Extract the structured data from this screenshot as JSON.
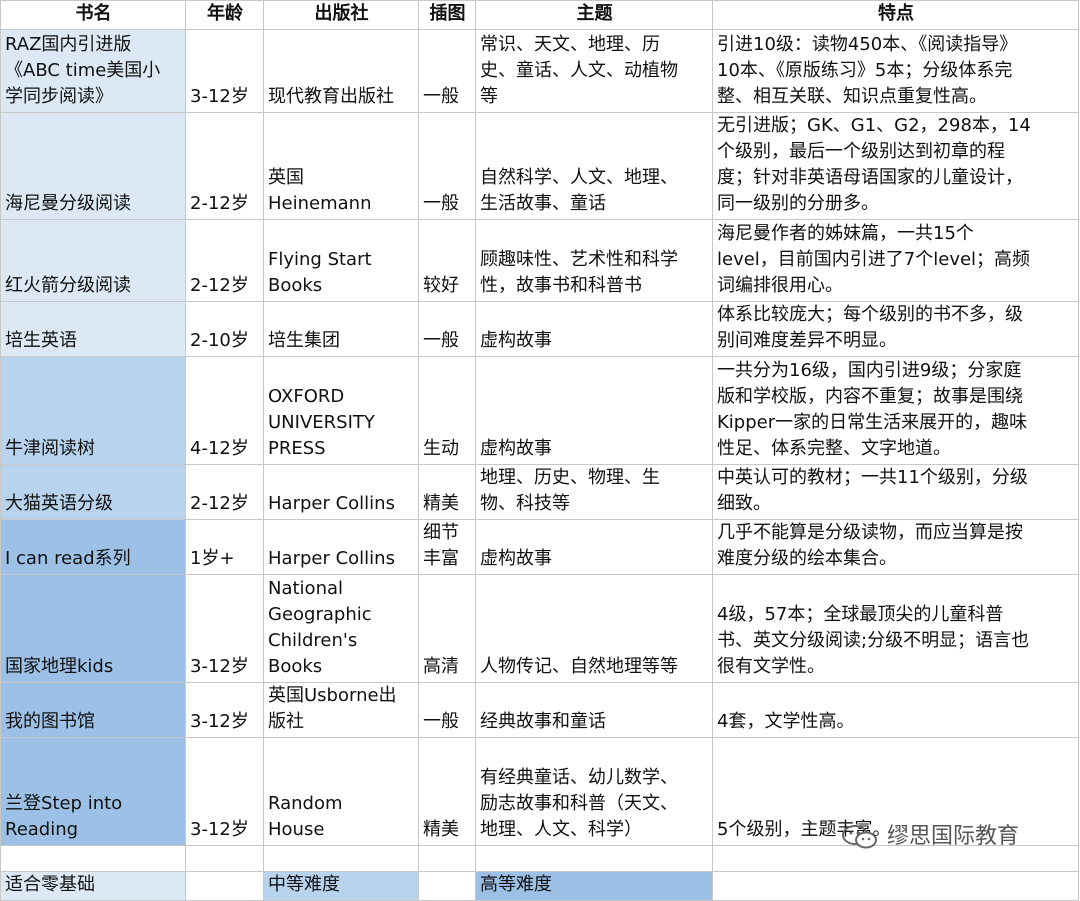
{
  "headers": [
    "书名",
    "年龄",
    "出版社",
    "插图",
    "主题",
    "特点"
  ],
  "rows": [
    {
      "level": "lvl1",
      "cells": [
        "RAZ国内引进版\n《ABC time美国小\n学同步阅读》",
        "3-12岁",
        "现代教育出版社",
        "一般",
        "常识、天文、地理、历\n史、童话、人文、动植物\n等",
        "引进10级：读物450本、《阅读指导》\n10本、《原版练习》5本；分级体系完\n整、相互关联、知识点重复性高。"
      ]
    },
    {
      "level": "lvl1",
      "cells": [
        "海尼曼分级阅读",
        "2-12岁",
        "英国\nHeinemann",
        "一般",
        "自然科学、人文、地理、\n生活故事、童话",
        "无引进版；GK、G1、G2，298本，14\n个级别，最后一个级别达到初章的程\n度；针对非英语母语国家的儿童设计，\n同一级别的分册多。"
      ]
    },
    {
      "level": "lvl1",
      "cells": [
        "红火箭分级阅读",
        "2-12岁",
        "Flying Start\nBooks",
        "较好",
        "顾趣味性、艺术性和科学\n性，故事书和科普书",
        "海尼曼作者的姊妹篇，一共15个\nlevel，目前国内引进了7个level；高频\n词编排很用心。"
      ]
    },
    {
      "level": "lvl1",
      "cells": [
        "培生英语",
        "2-10岁",
        "培生集团",
        "一般",
        "虚构故事",
        "体系比较庞大；每个级别的书不多，级\n别间难度差异不明显。"
      ]
    },
    {
      "level": "lvl2",
      "cells": [
        "牛津阅读树",
        "4-12岁",
        "OXFORD\nUNIVERSITY\nPRESS",
        "生动",
        "虚构故事",
        "一共分为16级，国内引进9级；分家庭\n版和学校版，内容不重复；故事是围绕\nKipper一家的日常生活来展开的，趣味\n性足、体系完整、文字地道。"
      ]
    },
    {
      "level": "lvl2",
      "cells": [
        "大猫英语分级",
        "2-12岁",
        "Harper Collins",
        "精美",
        "地理、历史、物理、生\n物、科技等",
        "中英认可的教材；一共11个级别，分级\n细致。"
      ]
    },
    {
      "level": "lvl3",
      "cells": [
        "I can read系列",
        "1岁+",
        "Harper Collins",
        "细节\n丰富",
        "虚构故事",
        "几乎不能算是分级读物，而应当算是按\n难度分级的绘本集合。"
      ]
    },
    {
      "level": "lvl3",
      "cells": [
        "国家地理kids",
        "3-12岁",
        "National\nGeographic\nChildren's\nBooks",
        "高清",
        "人物传记、自然地理等等",
        "4级，57本；全球最顶尖的儿童科普\n书、英文分级阅读;分级不明显；语言也\n很有文学性。"
      ]
    },
    {
      "level": "lvl3",
      "cells": [
        "我的图书馆",
        "3-12岁",
        "英国Usborne出\n版社",
        "一般",
        "经典故事和童话",
        "4套，文学性高。"
      ]
    },
    {
      "level": "lvl3",
      "cells": [
        "兰登Step into\nReading",
        "3-12岁",
        "Random\nHouse",
        "精美",
        "有经典童话、幼儿数学、\n励志故事和科普（天文、\n地理、人文、科学）",
        "5个级别，主题丰富。"
      ]
    }
  ],
  "legend": [
    "适合零基础",
    "中等难度",
    "高等难度"
  ],
  "watermark": "缪思国际教育",
  "colors": {
    "easy": "#dce9f5",
    "medium": "#b8d3ee",
    "hard": "#9dc1e6"
  }
}
